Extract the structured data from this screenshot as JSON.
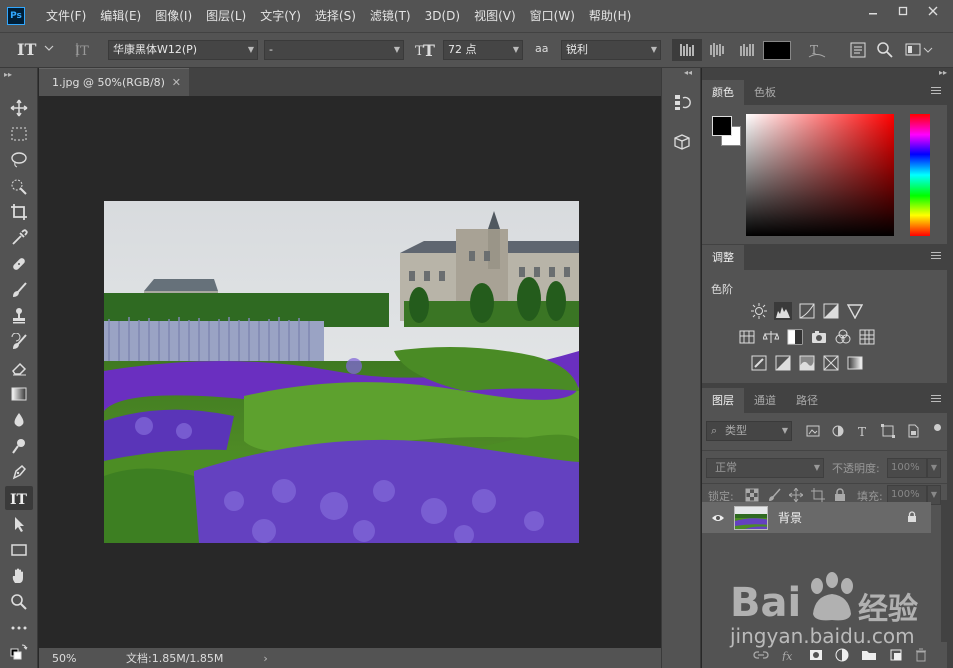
{
  "app": {
    "logo": "Ps",
    "menu": [
      "文件(F)",
      "编辑(E)",
      "图像(I)",
      "图层(L)",
      "文字(Y)",
      "选择(S)",
      "滤镜(T)",
      "3D(D)",
      "视图(V)",
      "窗口(W)",
      "帮助(H)"
    ]
  },
  "options": {
    "font_family": "华康黑体W12(P)",
    "font_style": "-",
    "font_size": "72 点",
    "antialias_icon_text": "aa",
    "antialias": "锐利",
    "text_color": "#000000"
  },
  "document": {
    "tab_title": "1.jpg @ 50%(RGB/8)",
    "zoom": "50%",
    "doc_size": "文档:1.85M/1.85M"
  },
  "color_panel": {
    "tabs": [
      "颜色",
      "色板"
    ],
    "foreground": "#000000",
    "background": "#ffffff",
    "hue_color": "#ff0000"
  },
  "adjust_panel": {
    "tab": "调整",
    "section_label": "色阶"
  },
  "layers_panel": {
    "tabs": [
      "图层",
      "通道",
      "路径"
    ],
    "filter_placeholder": "类型",
    "blend_mode": "正常",
    "opacity_label": "不透明度:",
    "opacity_value": "100%",
    "lock_label": "锁定:",
    "fill_label": "填充:",
    "fill_value": "100%",
    "layers": [
      {
        "name": "背景",
        "visible": true,
        "locked": true
      }
    ]
  },
  "watermark": {
    "brand": "Bai",
    "brand_cn": "经验",
    "url": "jingyan.baidu.com"
  }
}
